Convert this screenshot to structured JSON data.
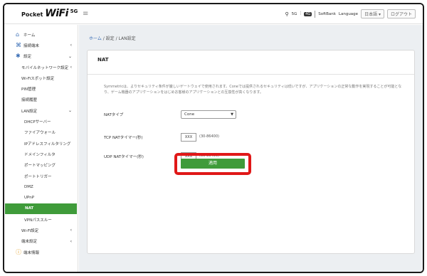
{
  "app": {
    "logo_small": "Pocket",
    "logo_big": "WiFi",
    "logo_sup": "5G"
  },
  "header": {
    "menu_icon": "hamburger-icon",
    "signal_text": "5G",
    "carrier_badge": "4G",
    "carrier": "SoftBank",
    "language_label": "Language",
    "language_value": "日本語 ▾",
    "logout_label": "ログアウト"
  },
  "sidebar": {
    "items": [
      {
        "label": "ホーム",
        "level": 0,
        "icon": "home-icon",
        "chev": ""
      },
      {
        "label": "接続端末",
        "level": 0,
        "icon": "devices-icon",
        "chev": "‹"
      },
      {
        "label": "設定",
        "level": 0,
        "icon": "gear-icon",
        "chev": "⌄"
      },
      {
        "label": "モバイルネットワーク設定",
        "level": 1,
        "icon": "",
        "chev": "‹"
      },
      {
        "label": "Wi-Fiスポット設定",
        "level": 1,
        "icon": "",
        "chev": ""
      },
      {
        "label": "PIN管理",
        "level": 1,
        "icon": "",
        "chev": ""
      },
      {
        "label": "接続履歴",
        "level": 1,
        "icon": "",
        "chev": ""
      },
      {
        "label": "LAN設定",
        "level": 1,
        "icon": "",
        "chev": "⌄"
      },
      {
        "label": "DHCPサーバー",
        "level": 2,
        "icon": "",
        "chev": ""
      },
      {
        "label": "ファイアウォール",
        "level": 2,
        "icon": "",
        "chev": ""
      },
      {
        "label": "IPアドレスフィルタリング",
        "level": 2,
        "icon": "",
        "chev": ""
      },
      {
        "label": "ドメインフィルタ",
        "level": 2,
        "icon": "",
        "chev": ""
      },
      {
        "label": "ポートマッピング",
        "level": 2,
        "icon": "",
        "chev": ""
      },
      {
        "label": "ポートトリガー",
        "level": 2,
        "icon": "",
        "chev": ""
      },
      {
        "label": "DMZ",
        "level": 2,
        "icon": "",
        "chev": ""
      },
      {
        "label": "UPnP",
        "level": 2,
        "icon": "",
        "chev": ""
      },
      {
        "label": "NAT",
        "level": 2,
        "icon": "",
        "chev": "",
        "active": true
      },
      {
        "label": "VPNパススルー",
        "level": 2,
        "icon": "",
        "chev": ""
      },
      {
        "label": "Wi-Fi設定",
        "level": 1,
        "icon": "",
        "chev": "‹"
      },
      {
        "label": "端末設定",
        "level": 1,
        "icon": "",
        "chev": "‹"
      },
      {
        "label": "端末情報",
        "level": 0,
        "icon": "info-icon",
        "chev": ""
      }
    ]
  },
  "breadcrumb": {
    "home": "ホーム",
    "rest": " / 設定 / LAN設定"
  },
  "card": {
    "title": "NAT",
    "description": "Symmetricは、よりセキュリティ条件が厳しいゲートウェイで使用されます。Coneでは提供されるセキュリティは低いですが、アプリケーションの正常な動作を実現することが可能となり、ゲーム機器のアプリケーションをはじめお客様のアプリケーションとの互換性が高くなります。",
    "nat_type_label": "NATタイプ",
    "nat_type_value": "Cone",
    "tcp_label": "TCP NATタイマー(秒)",
    "tcp_value": "XXX",
    "tcp_range": "(30-86400)",
    "udp_label": "UDP NATタイマー(秒)",
    "udp_value": "XXX",
    "udp_range": "(30-86400)",
    "apply_label": "適用"
  },
  "colors": {
    "accent_green": "#3f9b3a",
    "highlight_red": "#e01818",
    "link_blue": "#3b6fb6"
  }
}
